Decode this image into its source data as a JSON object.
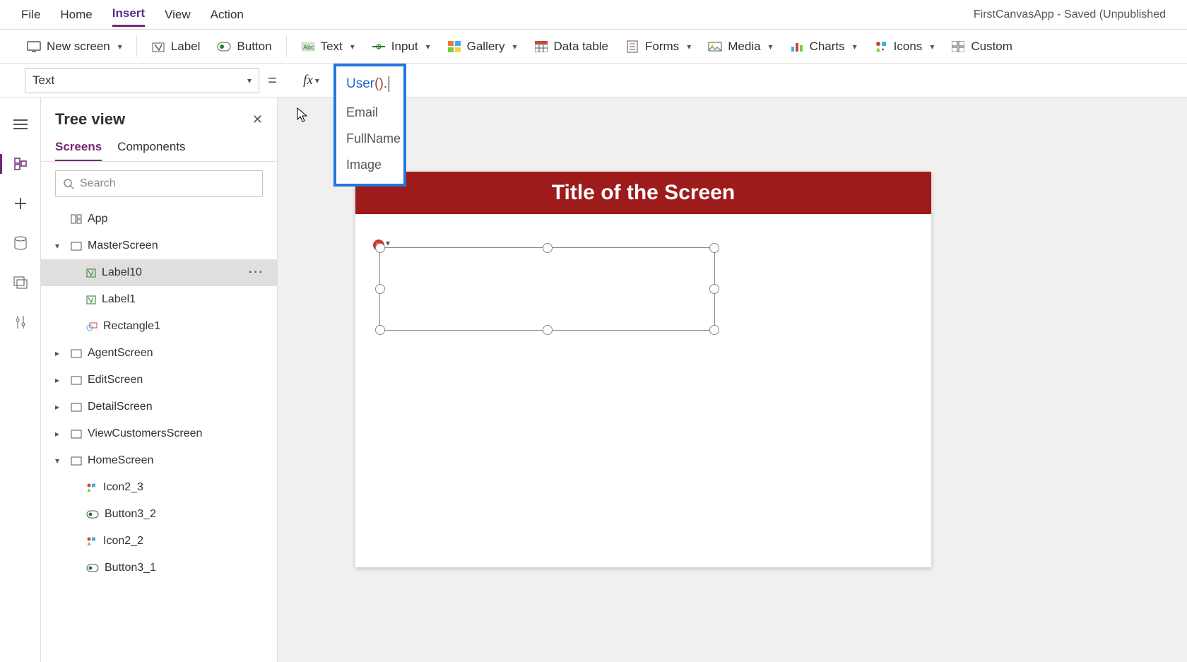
{
  "menubar": {
    "items": [
      "File",
      "Home",
      "Insert",
      "View",
      "Action"
    ],
    "active": "Insert",
    "app_title": "FirstCanvasApp - Saved (Unpublished"
  },
  "ribbon": {
    "new_screen": "New screen",
    "label": "Label",
    "button": "Button",
    "text": "Text",
    "input": "Input",
    "gallery": "Gallery",
    "data_table": "Data table",
    "forms": "Forms",
    "media": "Media",
    "charts": "Charts",
    "icons": "Icons",
    "custom": "Custom"
  },
  "formula_bar": {
    "property": "Text",
    "fx": "fx"
  },
  "formula_popup": {
    "fn_name": "User",
    "parens": "().",
    "suggestions": [
      "Email",
      "FullName",
      "Image"
    ]
  },
  "tree": {
    "title": "Tree view",
    "tabs": [
      "Screens",
      "Components"
    ],
    "active_tab": "Screens",
    "search_placeholder": "Search",
    "app_label": "App",
    "screens": [
      {
        "name": "MasterScreen",
        "items": [
          "Label10",
          "Label1",
          "Rectangle1"
        ],
        "expanded": true
      },
      {
        "name": "AgentScreen",
        "items": [],
        "expanded": false
      },
      {
        "name": "EditScreen",
        "items": [],
        "expanded": false
      },
      {
        "name": "DetailScreen",
        "items": [],
        "expanded": false
      },
      {
        "name": "ViewCustomersScreen",
        "items": [],
        "expanded": false
      },
      {
        "name": "HomeScreen",
        "items": [
          "Icon2_3",
          "Button3_2",
          "Icon2_2",
          "Button3_1"
        ],
        "expanded": true
      }
    ],
    "selected": "Label10"
  },
  "canvas": {
    "title": "Title of the Screen"
  }
}
